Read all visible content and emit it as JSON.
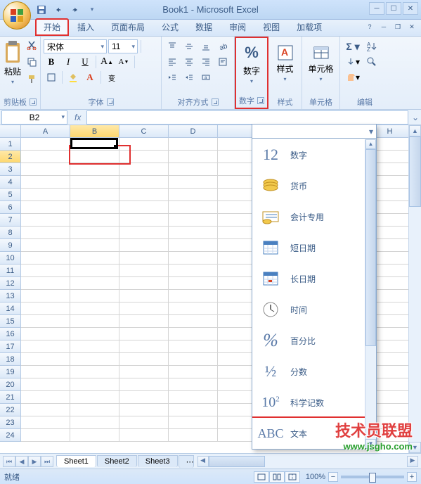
{
  "title": "Book1 - Microsoft Excel",
  "tabs": {
    "home": "开始",
    "insert": "插入",
    "layout": "页面布局",
    "formulas": "公式",
    "data": "数据",
    "review": "审阅",
    "view": "视图",
    "addins": "加载项"
  },
  "ribbon": {
    "clipboard": {
      "label": "剪贴板",
      "paste": "粘贴"
    },
    "font": {
      "label": "字体",
      "name": "宋体",
      "size": "11",
      "bold": "B",
      "italic": "I",
      "underline": "U"
    },
    "alignment": {
      "label": "对齐方式"
    },
    "number": {
      "label": "数字",
      "button": "数字",
      "symbol": "%"
    },
    "styles": {
      "label": "样式",
      "button": "样式"
    },
    "cells": {
      "label": "单元格",
      "button": "单元格"
    },
    "editing": {
      "label": "编辑"
    }
  },
  "formula_bar": {
    "name_box": "B2",
    "fx": "fx"
  },
  "columns": [
    "A",
    "B",
    "C",
    "D",
    "",
    "",
    "",
    "H"
  ],
  "selected_col_index": 1,
  "selected_row_index": 1,
  "row_count": 24,
  "sheets": {
    "s1": "Sheet1",
    "s2": "Sheet2",
    "s3": "Sheet3"
  },
  "status": {
    "ready": "就绪",
    "zoom": "100%"
  },
  "number_format_dropdown": {
    "selected": "",
    "items": [
      {
        "icon": "12",
        "label": "数字"
      },
      {
        "icon": "currency",
        "label": "货币"
      },
      {
        "icon": "accounting",
        "label": "会计专用"
      },
      {
        "icon": "short-date",
        "label": "短日期"
      },
      {
        "icon": "long-date",
        "label": "长日期"
      },
      {
        "icon": "time",
        "label": "时间"
      },
      {
        "icon": "percent",
        "label": "百分比"
      },
      {
        "icon": "fraction",
        "label": "分数"
      },
      {
        "icon": "scientific",
        "label": "科学记数"
      },
      {
        "icon": "text",
        "label": "文本"
      }
    ]
  },
  "watermark": {
    "line1": "技术员联盟",
    "line2": "www.jsgho.com"
  }
}
